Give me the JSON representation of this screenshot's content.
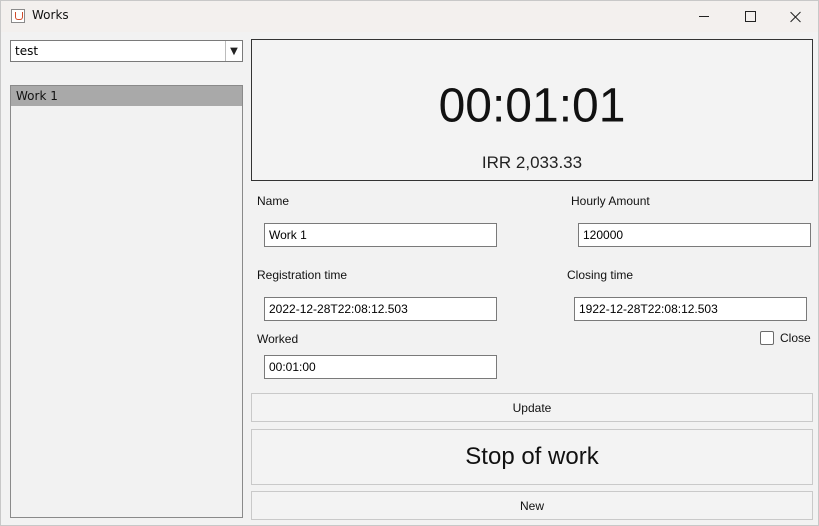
{
  "window": {
    "title": "Works"
  },
  "project_selector": {
    "value": "test"
  },
  "works_list": {
    "items": [
      "Work 1"
    ]
  },
  "timer": {
    "time": "00:01:01",
    "amount": "IRR 2,033.33"
  },
  "form": {
    "name_label": "Name",
    "name_value": "Work 1",
    "hourly_label": "Hourly Amount",
    "hourly_value": "120000",
    "registration_label": "Registration time",
    "registration_value": "2022-12-28T22:08:12.503",
    "closing_label": "Closing time",
    "closing_value": "1922-12-28T22:08:12.503",
    "worked_label": "Worked",
    "worked_value": "00:01:00",
    "close_label": "Close",
    "close_checked": false
  },
  "buttons": {
    "update": "Update",
    "stop": "Stop of work",
    "new": "New"
  },
  "icons": {
    "app": "java-app-icon",
    "dropdown": "chevron-down-icon"
  }
}
